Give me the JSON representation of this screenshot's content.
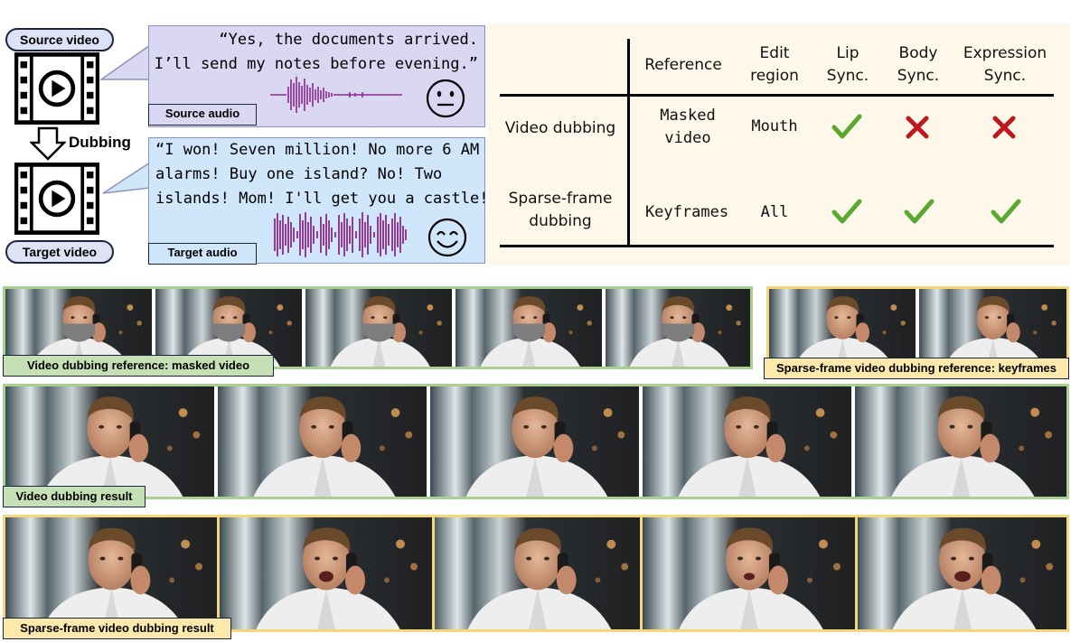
{
  "diagram": {
    "pills": {
      "source_video": "Source video",
      "target_video": "Target video"
    },
    "dubbing_label": "Dubbing",
    "source_bubble": {
      "quote_line1": "“Yes, the documents arrived.",
      "quote_line2": "I’ll send my notes before evening.”",
      "audio_label": "Source audio",
      "emoji": "neutral-face-icon"
    },
    "target_bubble": {
      "quote_line1": "“I won! Seven million! No more 6 AM",
      "quote_line2": "alarms! Buy one island? No! Two",
      "quote_line3": "islands! Mom! I'll get you a castle! “",
      "audio_label": "Target audio",
      "emoji": "smiling-face-icon"
    },
    "colors": {
      "source_bubble_bg": "#d9d7f2",
      "target_bubble_bg": "#cfe6fb",
      "waveform": "#8b2a8e",
      "green_frame": "#a9d08e",
      "yellow_frame": "#f4d77b",
      "check": "#5ba82e",
      "cross": "#c0171e"
    }
  },
  "table": {
    "headers": {
      "reference": "Reference",
      "edit_region_1": "Edit",
      "edit_region_2": "region",
      "lip_1": "Lip",
      "lip_2": "Sync.",
      "body_1": "Body",
      "body_2": "Sync.",
      "expr_1": "Expression",
      "expr_2": "Sync."
    },
    "rows": [
      {
        "method": "Video dubbing",
        "reference_1": "Masked",
        "reference_2": "video",
        "edit_region": "Mouth",
        "lip": "check",
        "body": "cross",
        "expression": "cross"
      },
      {
        "method_1": "Sparse-frame",
        "method_2": "dubbing",
        "reference": "Keyframes",
        "edit_region": "All",
        "lip": "check",
        "body": "check",
        "expression": "check"
      }
    ]
  },
  "strips": {
    "masked_label": "Video dubbing reference: masked video",
    "keyframes_label": "Sparse-frame video dubbing reference: keyframes",
    "dubbing_result_label": "Video dubbing result",
    "sparse_result_label": "Sparse-frame video dubbing result"
  }
}
